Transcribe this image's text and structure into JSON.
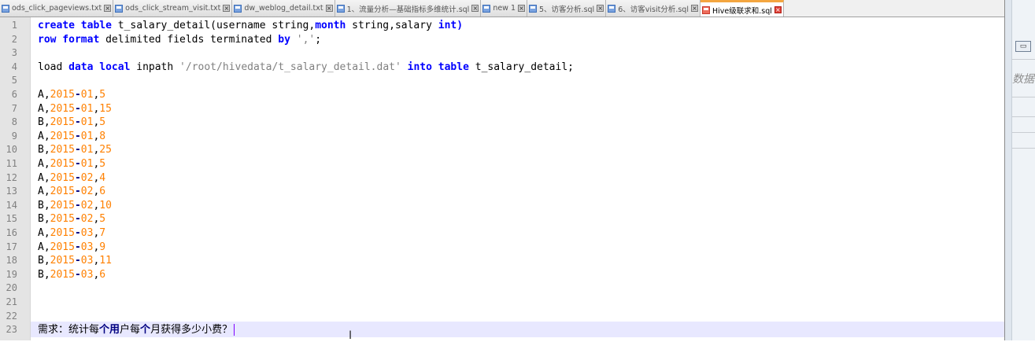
{
  "tabs": [
    {
      "label": "ods_click_pageviews.txt",
      "active": false
    },
    {
      "label": "ods_click_stream_visit.txt",
      "active": false
    },
    {
      "label": "dw_weblog_detail.txt",
      "active": false
    },
    {
      "label": "1、流量分析—基础指标多维统计.sql",
      "active": false
    },
    {
      "label": "new 1",
      "active": false
    },
    {
      "label": "5、访客分析.sql",
      "active": false
    },
    {
      "label": "6、访客visit分析.sql",
      "active": false
    },
    {
      "label": "Hive级联求和.sql",
      "active": true
    }
  ],
  "tab_close_glyph": "×",
  "editor": {
    "line_numbers": [
      "1",
      "2",
      "3",
      "4",
      "5",
      "6",
      "7",
      "8",
      "9",
      "10",
      "11",
      "12",
      "13",
      "14",
      "15",
      "16",
      "17",
      "18",
      "19",
      "20",
      "21",
      "22",
      "23"
    ],
    "code": {
      "l1": {
        "kw1": "create table",
        "t1": " t_salary_detail(username string,",
        "kw2": "month",
        "t2": " string,salary ",
        "kw3": "int)"
      },
      "l2": {
        "kw1": "row format",
        "t1": " delimited fields terminated ",
        "kw2": "by",
        "t2": " ",
        "s1": "','",
        "t3": ";"
      },
      "l4": {
        "t1": "load ",
        "kw1": "data local",
        "t2": " inpath ",
        "s1": "'/root/hivedata/t_salary_detail.dat'",
        "t3": " ",
        "kw2": "into table",
        "t4": " t_salary_detail;"
      },
      "data_rows": [
        {
          "user": "A",
          "year": "2015",
          "month": "01",
          "amount": "5"
        },
        {
          "user": "A",
          "year": "2015",
          "month": "01",
          "amount": "15"
        },
        {
          "user": "B",
          "year": "2015",
          "month": "01",
          "amount": "5"
        },
        {
          "user": "A",
          "year": "2015",
          "month": "01",
          "amount": "8"
        },
        {
          "user": "B",
          "year": "2015",
          "month": "01",
          "amount": "25"
        },
        {
          "user": "A",
          "year": "2015",
          "month": "01",
          "amount": "5"
        },
        {
          "user": "A",
          "year": "2015",
          "month": "02",
          "amount": "4"
        },
        {
          "user": "A",
          "year": "2015",
          "month": "02",
          "amount": "6"
        },
        {
          "user": "B",
          "year": "2015",
          "month": "02",
          "amount": "10"
        },
        {
          "user": "B",
          "year": "2015",
          "month": "02",
          "amount": "5"
        },
        {
          "user": "A",
          "year": "2015",
          "month": "03",
          "amount": "7"
        },
        {
          "user": "A",
          "year": "2015",
          "month": "03",
          "amount": "9"
        },
        {
          "user": "B",
          "year": "2015",
          "month": "03",
          "amount": "11"
        },
        {
          "user": "B",
          "year": "2015",
          "month": "03",
          "amount": "6"
        }
      ],
      "l23": {
        "p1": "需求：统计每",
        "b1": "个用",
        "p2": "户每",
        "b2": "个",
        "p3": "月获得多少小费？"
      }
    }
  },
  "sidepanel": {
    "button_glyph": "▭",
    "label": "数据"
  },
  "colors": {
    "keyword": "#0000ff",
    "string": "#808080",
    "number": "#ff8000",
    "operator": "#000080",
    "current_line": "#e8e8ff",
    "active_tab_accent": "#f4a640"
  }
}
